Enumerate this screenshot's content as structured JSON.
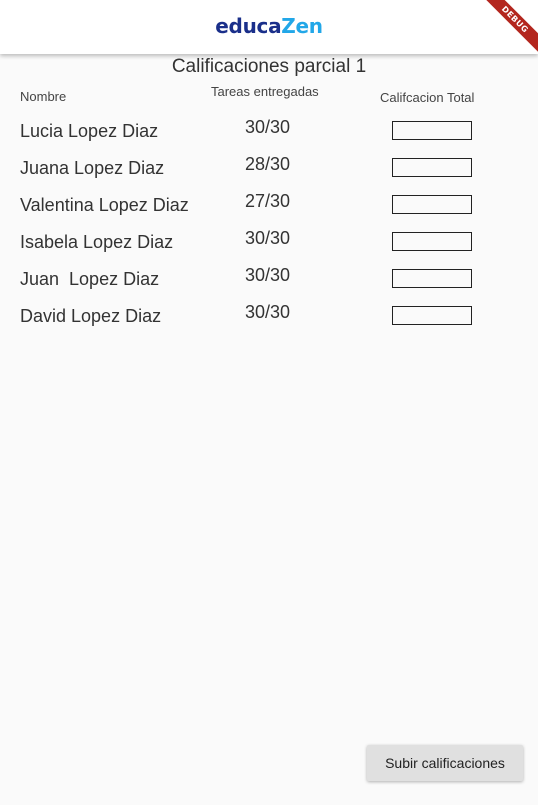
{
  "appbar": {
    "logo_part1": "educa",
    "logo_part2": "Zen",
    "debug_label": "DEBUG"
  },
  "page": {
    "title": "Calificaciones parcial 1"
  },
  "table": {
    "headers": {
      "nombre": "Nombre",
      "tareas": "Tareas entregadas",
      "total": "Califcacion Total"
    },
    "rows": [
      {
        "name": "Lucia Lopez Diaz",
        "score": "30/30",
        "total": ""
      },
      {
        "name": "Juana Lopez Diaz",
        "score": "28/30",
        "total": ""
      },
      {
        "name": "Valentina Lopez Diaz",
        "score": "27/30",
        "total": ""
      },
      {
        "name": "Isabela Lopez Diaz",
        "score": "30/30",
        "total": ""
      },
      {
        "name": "Juan  Lopez Diaz",
        "score": "30/30",
        "total": ""
      },
      {
        "name": "David Lopez Diaz",
        "score": "30/30",
        "total": ""
      }
    ]
  },
  "actions": {
    "submit_label": "Subir calificaciones"
  },
  "colors": {
    "logo_dark": "#1a2f8a",
    "logo_light": "#22a7e8",
    "background": "#fafafa",
    "debug_ribbon": "#b3261e"
  }
}
